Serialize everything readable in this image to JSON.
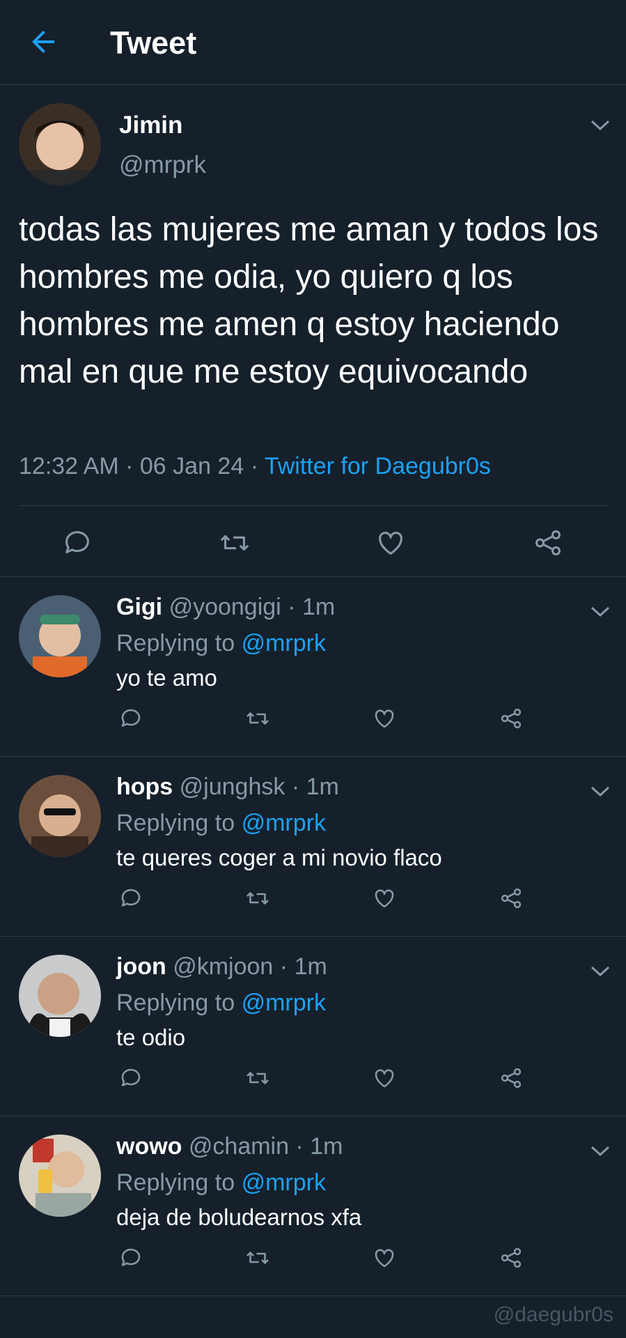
{
  "header": {
    "title": "Tweet",
    "back_icon": "back-arrow-icon"
  },
  "tweet": {
    "author_name": "Jimin",
    "author_handle": "@mrprk",
    "text": "todas las mujeres me aman y todos los hombres me odia, yo quiero q los hombres me amen q estoy haciendo mal en que me estoy equivocando",
    "time": "12:32 AM",
    "date": "06 Jan 24",
    "source": "Twitter for Daegubr0s"
  },
  "replies": [
    {
      "name": "Gigi",
      "handle": "@yoongigi",
      "age": "1m",
      "replying_label": "Replying to",
      "replying_to": "@mrprk",
      "text": "yo te amo"
    },
    {
      "name": "hops",
      "handle": "@junghsk",
      "age": "1m",
      "replying_label": "Replying to",
      "replying_to": "@mrprk",
      "text": "te queres coger a mi novio flaco"
    },
    {
      "name": "joon",
      "handle": "@kmjoon",
      "age": "1m",
      "replying_label": "Replying to",
      "replying_to": "@mrprk",
      "text": "te odio"
    },
    {
      "name": "wowo",
      "handle": "@chamin",
      "age": "1m",
      "replying_label": "Replying to",
      "replying_to": "@mrprk",
      "text": "deja de boludearnos xfa"
    }
  ],
  "watermark": "@daegubr0s",
  "colors": {
    "background": "#15202b",
    "accent": "#1da1f2",
    "muted": "#8899a6",
    "divider": "#2f3b47"
  }
}
